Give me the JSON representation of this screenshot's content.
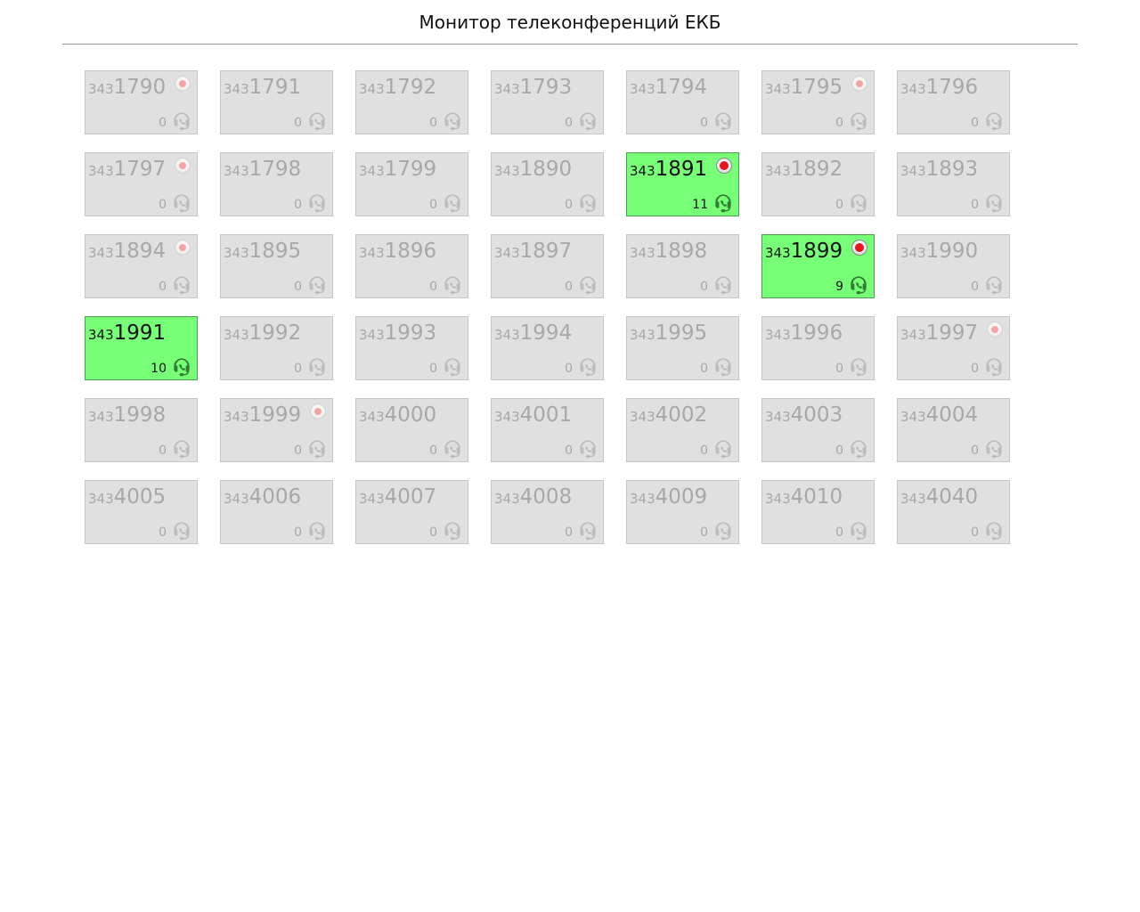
{
  "title": "Монитор телеконференций ЕКБ",
  "colors": {
    "active_bg": "#77ff77",
    "inactive_bg": "#e0e0e0",
    "inactive_text": "#a8a8a8",
    "record_active": "#e8141c",
    "record_inactive": "#f4a3a3",
    "phone_active": "#2e7d32",
    "phone_inactive": "#bdbdbd"
  },
  "icons": {
    "record": "record-indicator-icon",
    "phone": "headset-phone-icon"
  },
  "conferences": [
    {
      "prefix": "343",
      "ext": "1790",
      "count": "0",
      "active": false,
      "rec": true
    },
    {
      "prefix": "343",
      "ext": "1791",
      "count": "0",
      "active": false,
      "rec": false
    },
    {
      "prefix": "343",
      "ext": "1792",
      "count": "0",
      "active": false,
      "rec": false
    },
    {
      "prefix": "343",
      "ext": "1793",
      "count": "0",
      "active": false,
      "rec": false
    },
    {
      "prefix": "343",
      "ext": "1794",
      "count": "0",
      "active": false,
      "rec": false
    },
    {
      "prefix": "343",
      "ext": "1795",
      "count": "0",
      "active": false,
      "rec": true
    },
    {
      "prefix": "343",
      "ext": "1796",
      "count": "0",
      "active": false,
      "rec": false
    },
    {
      "prefix": "343",
      "ext": "1797",
      "count": "0",
      "active": false,
      "rec": true
    },
    {
      "prefix": "343",
      "ext": "1798",
      "count": "0",
      "active": false,
      "rec": false
    },
    {
      "prefix": "343",
      "ext": "1799",
      "count": "0",
      "active": false,
      "rec": false
    },
    {
      "prefix": "343",
      "ext": "1890",
      "count": "0",
      "active": false,
      "rec": false
    },
    {
      "prefix": "343",
      "ext": "1891",
      "count": "11",
      "active": true,
      "rec": true
    },
    {
      "prefix": "343",
      "ext": "1892",
      "count": "0",
      "active": false,
      "rec": false
    },
    {
      "prefix": "343",
      "ext": "1893",
      "count": "0",
      "active": false,
      "rec": false
    },
    {
      "prefix": "343",
      "ext": "1894",
      "count": "0",
      "active": false,
      "rec": true
    },
    {
      "prefix": "343",
      "ext": "1895",
      "count": "0",
      "active": false,
      "rec": false
    },
    {
      "prefix": "343",
      "ext": "1896",
      "count": "0",
      "active": false,
      "rec": false
    },
    {
      "prefix": "343",
      "ext": "1897",
      "count": "0",
      "active": false,
      "rec": false
    },
    {
      "prefix": "343",
      "ext": "1898",
      "count": "0",
      "active": false,
      "rec": false
    },
    {
      "prefix": "343",
      "ext": "1899",
      "count": "9",
      "active": true,
      "rec": true
    },
    {
      "prefix": "343",
      "ext": "1990",
      "count": "0",
      "active": false,
      "rec": false
    },
    {
      "prefix": "343",
      "ext": "1991",
      "count": "10",
      "active": true,
      "rec": false
    },
    {
      "prefix": "343",
      "ext": "1992",
      "count": "0",
      "active": false,
      "rec": false
    },
    {
      "prefix": "343",
      "ext": "1993",
      "count": "0",
      "active": false,
      "rec": false
    },
    {
      "prefix": "343",
      "ext": "1994",
      "count": "0",
      "active": false,
      "rec": false
    },
    {
      "prefix": "343",
      "ext": "1995",
      "count": "0",
      "active": false,
      "rec": false
    },
    {
      "prefix": "343",
      "ext": "1996",
      "count": "0",
      "active": false,
      "rec": false
    },
    {
      "prefix": "343",
      "ext": "1997",
      "count": "0",
      "active": false,
      "rec": true
    },
    {
      "prefix": "343",
      "ext": "1998",
      "count": "0",
      "active": false,
      "rec": false
    },
    {
      "prefix": "343",
      "ext": "1999",
      "count": "0",
      "active": false,
      "rec": true
    },
    {
      "prefix": "343",
      "ext": "4000",
      "count": "0",
      "active": false,
      "rec": false
    },
    {
      "prefix": "343",
      "ext": "4001",
      "count": "0",
      "active": false,
      "rec": false
    },
    {
      "prefix": "343",
      "ext": "4002",
      "count": "0",
      "active": false,
      "rec": false
    },
    {
      "prefix": "343",
      "ext": "4003",
      "count": "0",
      "active": false,
      "rec": false
    },
    {
      "prefix": "343",
      "ext": "4004",
      "count": "0",
      "active": false,
      "rec": false
    },
    {
      "prefix": "343",
      "ext": "4005",
      "count": "0",
      "active": false,
      "rec": false
    },
    {
      "prefix": "343",
      "ext": "4006",
      "count": "0",
      "active": false,
      "rec": false
    },
    {
      "prefix": "343",
      "ext": "4007",
      "count": "0",
      "active": false,
      "rec": false
    },
    {
      "prefix": "343",
      "ext": "4008",
      "count": "0",
      "active": false,
      "rec": false
    },
    {
      "prefix": "343",
      "ext": "4009",
      "count": "0",
      "active": false,
      "rec": false
    },
    {
      "prefix": "343",
      "ext": "4010",
      "count": "0",
      "active": false,
      "rec": false
    },
    {
      "prefix": "343",
      "ext": "4040",
      "count": "0",
      "active": false,
      "rec": false
    }
  ]
}
